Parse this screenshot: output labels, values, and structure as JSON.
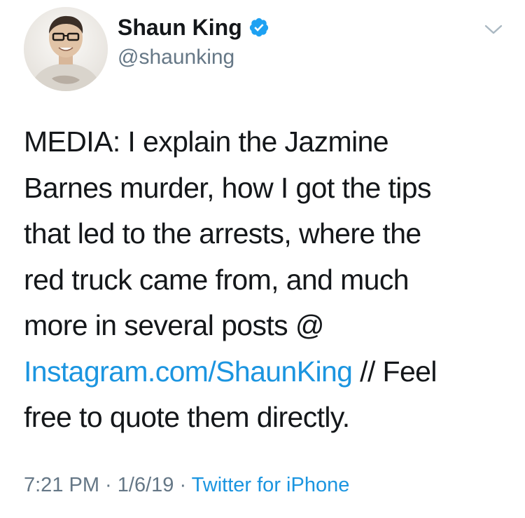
{
  "author": {
    "name": "Shaun King",
    "handle": "@shaunking",
    "verified": true
  },
  "icons": {
    "verified": "verified-badge-icon",
    "menu": "chevron-down-icon",
    "avatar": "profile-photo"
  },
  "tweet": {
    "lines": [
      "MEDIA: I explain the Jazmine",
      "Barnes murder, how I got the tips",
      "that led to the arrests, where the",
      "red truck came from, and much",
      "more in several posts @"
    ],
    "link_text": "Instagram.com/ShaunKing",
    "after_link": " // Feel",
    "last_line": "free to quote them directly."
  },
  "meta": {
    "time": "7:21 PM",
    "date": "1/6/19",
    "separator": " · ",
    "source": "Twitter for iPhone"
  },
  "colors": {
    "text": "#14171a",
    "secondary": "#657786",
    "link": "#1b95e0",
    "verified": "#1da1f2"
  }
}
